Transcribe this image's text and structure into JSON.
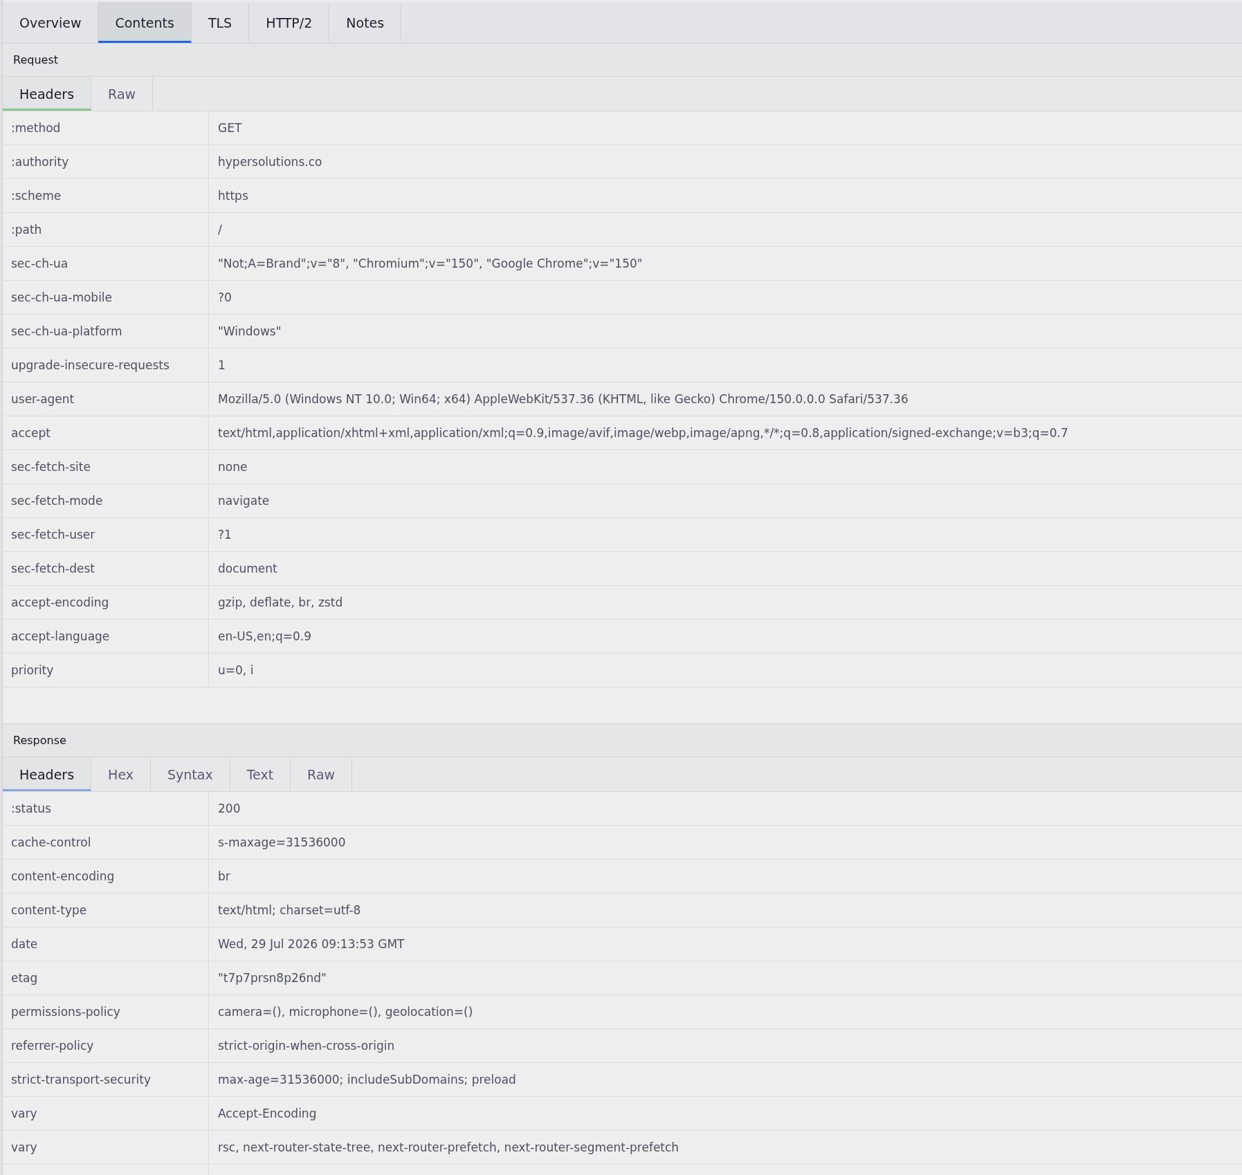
{
  "tabs": [
    {
      "label": "Overview",
      "selected": false
    },
    {
      "label": "Contents",
      "selected": true
    },
    {
      "label": "TLS",
      "selected": false
    },
    {
      "label": "HTTP/2",
      "selected": false
    },
    {
      "label": "Notes",
      "selected": false
    }
  ],
  "sections": [
    {
      "kind": "request",
      "title": "Request",
      "tabs": [
        {
          "label": "Headers",
          "selected": true
        },
        {
          "label": "Raw",
          "selected": false
        }
      ],
      "headers": [
        {
          "name": ":method",
          "value": "GET"
        },
        {
          "name": ":authority",
          "value": "hypersolutions.co"
        },
        {
          "name": ":scheme",
          "value": "https"
        },
        {
          "name": ":path",
          "value": "/"
        },
        {
          "name": "sec-ch-ua",
          "value": "\"Not;A=Brand\";v=\"8\", \"Chromium\";v=\"150\", \"Google Chrome\";v=\"150\""
        },
        {
          "name": "sec-ch-ua-mobile",
          "value": "?0"
        },
        {
          "name": "sec-ch-ua-platform",
          "value": "\"Windows\""
        },
        {
          "name": "upgrade-insecure-requests",
          "value": "1"
        },
        {
          "name": "user-agent",
          "value": "Mozilla/5.0 (Windows NT 10.0; Win64; x64) AppleWebKit/537.36 (KHTML, like Gecko) Chrome/150.0.0.0 Safari/537.36"
        },
        {
          "name": "accept",
          "value": "text/html,application/xhtml+xml,application/xml;q=0.9,image/avif,image/webp,image/apng,*/*;q=0.8,application/signed-exchange;v=b3;q=0.7"
        },
        {
          "name": "sec-fetch-site",
          "value": "none"
        },
        {
          "name": "sec-fetch-mode",
          "value": "navigate"
        },
        {
          "name": "sec-fetch-user",
          "value": "?1"
        },
        {
          "name": "sec-fetch-dest",
          "value": "document"
        },
        {
          "name": "accept-encoding",
          "value": "gzip, deflate, br, zstd"
        },
        {
          "name": "accept-language",
          "value": "en-US,en;q=0.9"
        },
        {
          "name": "priority",
          "value": "u=0, i"
        }
      ]
    },
    {
      "kind": "response",
      "title": "Response",
      "tabs": [
        {
          "label": "Headers",
          "selected": true
        },
        {
          "label": "Hex",
          "selected": false
        },
        {
          "label": "Syntax",
          "selected": false
        },
        {
          "label": "Text",
          "selected": false
        },
        {
          "label": "Raw",
          "selected": false
        }
      ],
      "headers": [
        {
          "name": ":status",
          "value": "200"
        },
        {
          "name": "cache-control",
          "value": "s-maxage=31536000"
        },
        {
          "name": "content-encoding",
          "value": "br"
        },
        {
          "name": "content-type",
          "value": "text/html; charset=utf-8"
        },
        {
          "name": "date",
          "value": "Wed, 29 Jul 2026 09:13:53 GMT"
        },
        {
          "name": "etag",
          "value": "\"t7p7prsn8p26nd\""
        },
        {
          "name": "permissions-policy",
          "value": "camera=(), microphone=(), geolocation=()"
        },
        {
          "name": "referrer-policy",
          "value": "strict-origin-when-cross-origin"
        },
        {
          "name": "strict-transport-security",
          "value": "max-age=31536000; includeSubDomains; preload"
        },
        {
          "name": "vary",
          "value": "Accept-Encoding"
        },
        {
          "name": "vary",
          "value": "rsc, next-router-state-tree, next-router-prefetch, next-router-segment-prefetch"
        }
      ]
    }
  ]
}
